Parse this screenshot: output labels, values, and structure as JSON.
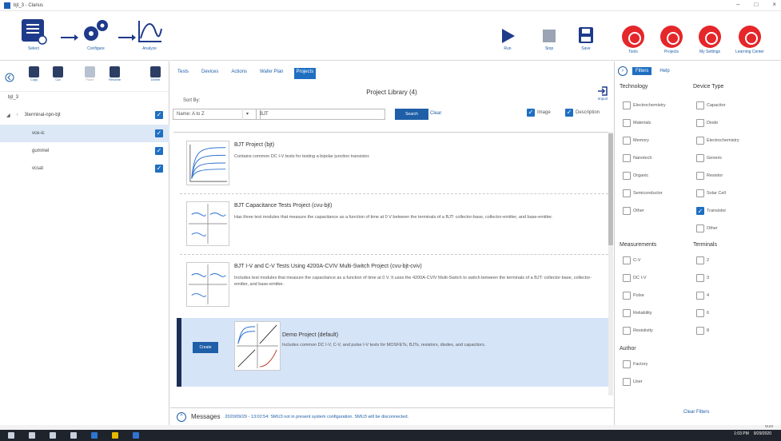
{
  "window": {
    "title": "bjt_3 - Clarius",
    "controls": [
      "–",
      "□",
      "×"
    ]
  },
  "toolbar": {
    "select_label": "Select",
    "configure_label": "Configure",
    "analyze_label": "Analyze",
    "run_label": "Run",
    "stop_label": "Stop",
    "save_label": "Save",
    "tools_label": "Tools",
    "projects_label": "Projects",
    "settings_label": "My Settings",
    "learning_label": "Learning Center"
  },
  "left_panel": {
    "tools": [
      {
        "label": "Copy"
      },
      {
        "label": "Cut"
      },
      {
        "label": "Paste"
      },
      {
        "label": "Rename"
      },
      {
        "label": "Delete"
      }
    ],
    "project_name": "bjt_3",
    "tree": [
      {
        "label": "3terminal-npn-bjt",
        "checked": true
      },
      {
        "label": "vce-ic",
        "checked": true,
        "selected": true
      },
      {
        "label": "gummel",
        "checked": true
      },
      {
        "label": "vcsat",
        "checked": true
      }
    ]
  },
  "center": {
    "tabs": [
      "Tests",
      "Devices",
      "Actions",
      "Wafer Plan",
      "Projects"
    ],
    "active_tab": "Projects",
    "library_title": "Project Library (4)",
    "import_label": "Import",
    "sort_by_label": "Sort By:",
    "sort_value": "Name: A to Z",
    "search_value": "BJT",
    "search_button": "Search",
    "clear_link": "Clear",
    "image_label": "Image",
    "description_label": "Description",
    "projects": [
      {
        "title": "BJT Project (bjt)",
        "description": "Contains common DC I-V tests for testing a bipolar junction transistor."
      },
      {
        "title": "BJT Capacitance Tests Project (cvu-bjt)",
        "description": "Has three test modules that measure the capacitance as a function of time at 0 V between the terminals of a BJT: collector-base, collector-emitter, and base-emitter."
      },
      {
        "title": "BJT I-V and C-V Tests Using 4200A-CVIV Multi-Switch Project (cvu-bjt-cviv)",
        "description": "Includes test modules that measure the capacitance as a function of time at 0 V. It uses the 4200A-CVIV Multi-Switch to switch between the terminals of a BJT: collector-base, collector-emitter, and base-emitter."
      },
      {
        "title": "Demo Project (default)",
        "description": "Includes common DC I-V, C-V, and pulse I-V tests for MOSFETs, BJTs, resistors, diodes, and capacitors.",
        "create_label": "Create"
      }
    ],
    "messages_label": "Messages",
    "message_text": "2020/09/29 - 13:02:54: SMU3 not in present system configuration. SMU3 will be disconnected."
  },
  "right_panel": {
    "tabs": [
      "Filters",
      "Help"
    ],
    "active_tab": "Filters",
    "technology_head": "Technology",
    "technology": [
      "Electrochemistry",
      "Materials",
      "Memory",
      "Nanotech",
      "Organic",
      "Semiconductor",
      "Other"
    ],
    "device_type_head": "Device Type",
    "device_type": [
      {
        "label": "Capacitor",
        "checked": false
      },
      {
        "label": "Diode",
        "checked": false
      },
      {
        "label": "Electrochemistry",
        "checked": false
      },
      {
        "label": "Generic",
        "checked": false
      },
      {
        "label": "Resistor",
        "checked": false
      },
      {
        "label": "Solar Cell",
        "checked": false
      },
      {
        "label": "Transistor",
        "checked": true
      },
      {
        "label": "Other",
        "checked": false
      }
    ],
    "measurements_head": "Measurements",
    "measurements": [
      "C-V",
      "DC I-V",
      "Pulse",
      "Reliability",
      "Resistivity"
    ],
    "terminals_head": "Terminals",
    "terminals": [
      "2",
      "3",
      "4",
      "6",
      "8"
    ],
    "author_head": "Author",
    "author": [
      "Factory",
      "User"
    ],
    "clear_filters": "Clear Filters"
  },
  "status": {
    "text": "NUM"
  },
  "taskbar": {
    "time": "1:03 PM",
    "date": "9/29/2020"
  },
  "colors": {
    "accent": "#1f6fc1",
    "toolbar_icon": "#1e3a8a",
    "red": "#e5262a",
    "selected_bg": "#d6e4f7"
  }
}
